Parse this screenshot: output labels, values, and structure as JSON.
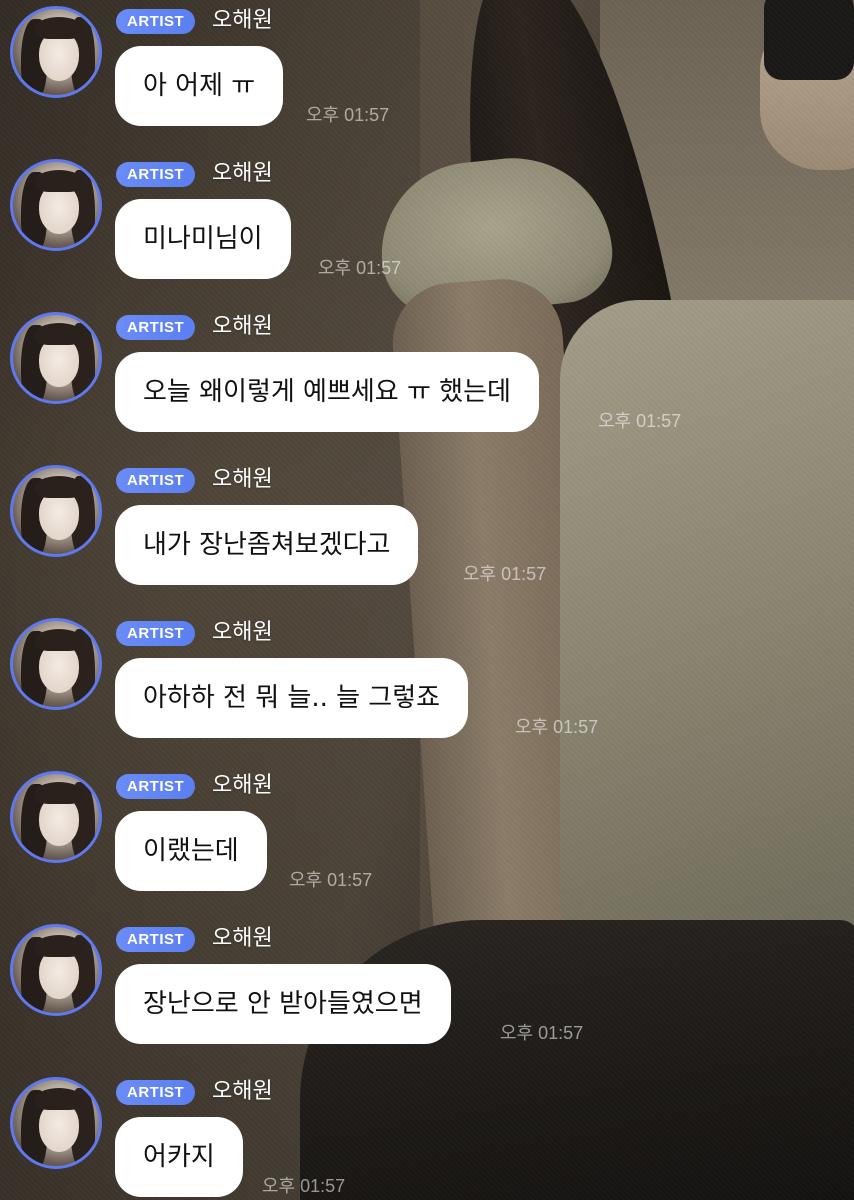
{
  "messages": [
    {
      "badge": "ARTIST",
      "sender": "오해원",
      "text": "아 어제 ㅠ",
      "time": "오후 01:57"
    },
    {
      "badge": "ARTIST",
      "sender": "오해원",
      "text": "미나미님이",
      "time": "오후 01:57"
    },
    {
      "badge": "ARTIST",
      "sender": "오해원",
      "text": "오늘 왜이렇게 예쁘세요 ㅠ 했는데",
      "time": "오후 01:57"
    },
    {
      "badge": "ARTIST",
      "sender": "오해원",
      "text": "내가 장난좀쳐보겠다고",
      "time": "오후 01:57"
    },
    {
      "badge": "ARTIST",
      "sender": "오해원",
      "text": "아하하 전 뭐 늘.. 늘 그렇죠",
      "time": "오후 01:57"
    },
    {
      "badge": "ARTIST",
      "sender": "오해원",
      "text": "이랬는데",
      "time": "오후 01:57"
    },
    {
      "badge": "ARTIST",
      "sender": "오해원",
      "text": "장난으로 안 받아들였으면",
      "time": "오후 01:57"
    },
    {
      "badge": "ARTIST",
      "sender": "오해원",
      "text": "어카지",
      "time": "오후 01:57"
    }
  ],
  "colors": {
    "badge": "#5f7ff0",
    "avatar_ring": "#5f79f0",
    "bubble": "#ffffff",
    "bubble_text": "#111111",
    "timestamp": "#bfbab3"
  },
  "icons": {
    "avatar": "profile-photo"
  }
}
